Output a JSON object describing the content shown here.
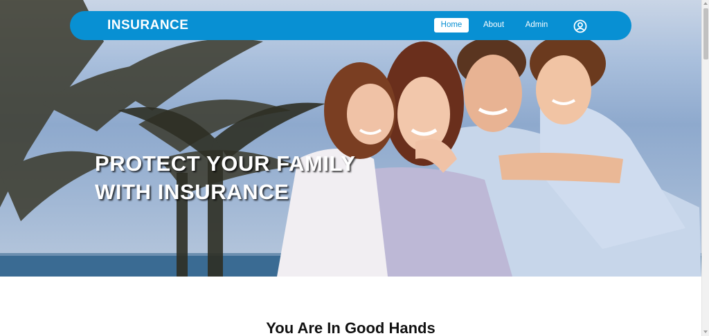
{
  "nav": {
    "brand": "INSURANCE",
    "items": [
      {
        "label": "Home",
        "active": true
      },
      {
        "label": "About",
        "active": false
      },
      {
        "label": "Admin",
        "active": false
      }
    ],
    "user_icon": "user-circle-icon"
  },
  "hero": {
    "title_line1": "PROTECT YOUR FAMILY",
    "title_line2": "WITH INSURANCE",
    "image": "family-on-beach-photo"
  },
  "section": {
    "title": "You Are In Good Hands"
  },
  "colors": {
    "brand": "#0890d3",
    "nav_text": "#ffffff",
    "active_bg": "#ffffff"
  }
}
